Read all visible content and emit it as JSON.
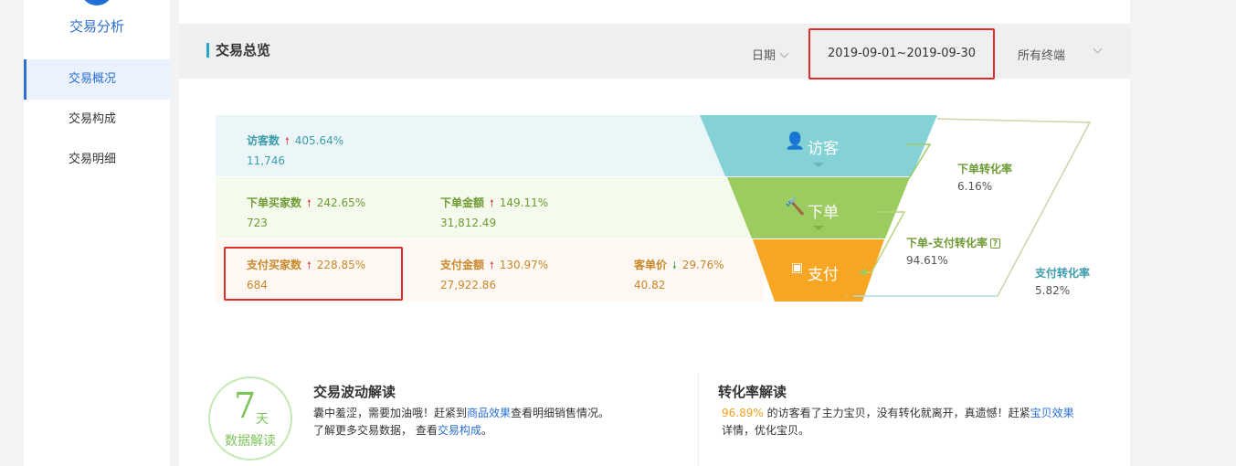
{
  "sidebar": {
    "title": "交易分析",
    "items": [
      {
        "label": "交易概况",
        "active": true
      },
      {
        "label": "交易构成",
        "active": false
      },
      {
        "label": "交易明细",
        "active": false
      }
    ]
  },
  "header": {
    "title": "交易总览",
    "date_label": "日期",
    "date_range": "2019-09-01~2019-09-30",
    "terminal_label": "所有终端"
  },
  "funnel": {
    "visitors": {
      "name": "访客数",
      "pct": "405.64%",
      "trend": "up",
      "value": "11,746"
    },
    "order_buyers": {
      "name": "下单买家数",
      "pct": "242.65%",
      "trend": "up",
      "value": "723"
    },
    "order_amount": {
      "name": "下单金额",
      "pct": "149.11%",
      "trend": "up",
      "value": "31,812.49"
    },
    "pay_buyers": {
      "name": "支付买家数",
      "pct": "228.85%",
      "trend": "up",
      "value": "684"
    },
    "pay_amount": {
      "name": "支付金额",
      "pct": "130.97%",
      "trend": "up",
      "value": "27,922.86"
    },
    "unit_price": {
      "name": "客单价",
      "pct": "29.76%",
      "trend": "down",
      "value": "40.82"
    },
    "stages": {
      "visit": "访客",
      "order": "下单",
      "pay": "支付"
    },
    "conversions": {
      "order_rate": {
        "name": "下单转化率",
        "value": "6.16%"
      },
      "order_pay_rate": {
        "name": "下单-支付转化率",
        "value": "94.61%"
      },
      "pay_rate": {
        "name": "支付转化率",
        "value": "5.82%"
      }
    },
    "colors": {
      "visit": "#84d2d6",
      "order": "#9ccc5f",
      "pay": "#f6a623"
    }
  },
  "insights": {
    "badge_num": "7",
    "badge_unit": "天",
    "badge_sub": "数据解读",
    "wave": {
      "title": "交易波动解读",
      "line1_pre": "囊中羞涩，需要加油哦！赶紧到",
      "line1_link": "商品效果",
      "line1_post": "查看明细销售情况。",
      "line2_pre": "了解更多交易数据， 查看",
      "line2_link": "交易构成",
      "line2_post": "。"
    },
    "conv": {
      "title": "转化率解读",
      "pct": "96.89%",
      "line1_post": " 的访客看了主力宝贝，没有转化就离开，真遗憾！赶紧",
      "line1_link": "宝贝效果",
      "line2": "详情，优化宝贝。"
    }
  }
}
